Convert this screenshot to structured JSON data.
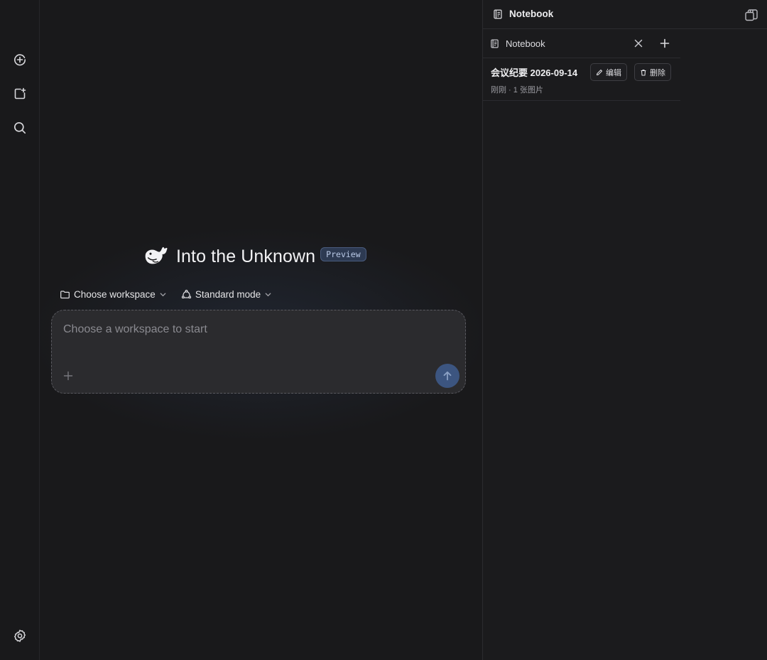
{
  "rail": {
    "items": [
      {
        "name": "new-chat",
        "icon": "plus-circle-icon"
      },
      {
        "name": "new-window",
        "icon": "window-plus-icon"
      },
      {
        "name": "search",
        "icon": "search-icon"
      }
    ],
    "bottom": {
      "name": "settings",
      "icon": "gear-icon"
    }
  },
  "hero": {
    "logo": "whale-logo-icon",
    "title": "Into the Unknown",
    "badge": "Preview"
  },
  "selectors": {
    "workspace_label": "Choose workspace",
    "mode_label": "Standard mode"
  },
  "composer": {
    "placeholder": "Choose a workspace to start",
    "value": ""
  },
  "panel": {
    "header_title": "Notebook",
    "tab_label": "Notebook",
    "notes": [
      {
        "title": "会议纪要 2026-09-14",
        "meta": "刚刚 · 1 张图片",
        "edit_label": "编辑",
        "delete_label": "删除"
      }
    ]
  },
  "colors": {
    "background": "#19191b",
    "composer_bg": "#2b2b2e",
    "send_button": "#3c5580",
    "badge_bg": "#2d3a52"
  }
}
